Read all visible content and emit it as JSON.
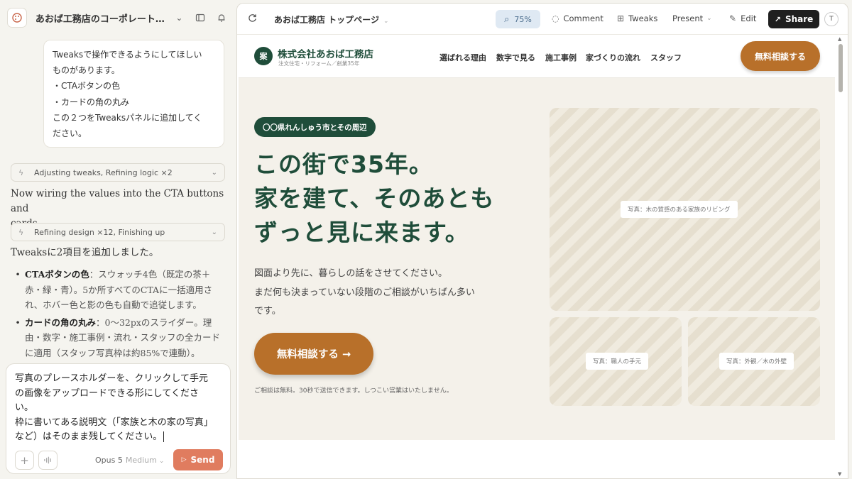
{
  "sidebar": {
    "project_title": "あおば工務店のコーポレート…",
    "user_message_lines": [
      "Tweaksで操作できるようにしてほしい",
      "ものがあります。",
      "・CTAボタンの色",
      "・カードの角の丸み",
      "この２つをTweaksパネルに追加してく",
      "ださい。"
    ],
    "status_1": "Adjusting tweaks, Refining logic ×2",
    "assistant_msg_1": [
      "Now wiring the values into the CTA buttons and",
      "cards."
    ],
    "status_2": "Refining design ×12, Finishing up",
    "assistant_msg_2": "Tweaksに2項目を追加しました。",
    "bullets": [
      {
        "title": "CTAボタンの色",
        "lines": [
          "：スウォッチ4色（既定の茶＋",
          "赤・緑・青）。5か所すべてのCTAに一括適用さ",
          "れ、ホバー色と影の色も自動で追従します。"
        ]
      },
      {
        "title": "カードの角の丸み",
        "lines": [
          "：0〜32pxのスライダー。理",
          "由・数字・施工事例・流れ・スタッフの全カード",
          "に適用（スタッフ写真枠は約85%で連動）。"
        ]
      }
    ],
    "composer_text": "写真のプレースホルダーを、クリックして手元\nの画像をアップロードできる形にしてくださ\nい。\n枠に書いてある説明文（「家族と木の家の写真」\nなど）はそのまま残してください。",
    "model_name": "Opus 5",
    "model_level": "Medium",
    "send_label": "Send"
  },
  "preview_toolbar": {
    "page_title": "あおば工務店 トップページ",
    "zoom": "75%",
    "comment_label": "Comment",
    "tweaks_label": "Tweaks",
    "present_label": "Present",
    "edit_label": "Edit",
    "share_label": "Share",
    "avatar_initial": "T"
  },
  "site": {
    "logo_mark": "案",
    "company_name": "株式会社あおば工務店",
    "company_sub": "注文住宅・リフォーム／創業35年",
    "nav_links": [
      "選ばれる理由",
      "数字で見る",
      "施工事例",
      "家づくりの流れ",
      "スタッフ"
    ],
    "nav_cta": "無料相談する",
    "region_badge": "〇〇県れんしゅう市とその周辺",
    "headline_lines": [
      "この街で35年。",
      "家を建て、そのあとも",
      "ずっと見に来ます。"
    ],
    "lead_lines": [
      "図面より先に、暮らしの話をさせてください。",
      "まだ何も決まっていない段階のご相談がいちばん多い",
      "です。"
    ],
    "hero_cta": "無料相談する →",
    "note": "ご相談は無料。30秒で送信できます。しつこい営業はいたしません。",
    "photos": {
      "main": "写真：木の質感のある家族のリビング",
      "sub1": "写真：職人の手元",
      "sub2": "写真：外観／木の外壁"
    }
  },
  "colors": {
    "brand_green": "#1f4d3a",
    "cta_brown": "#b8702a",
    "send_orange": "#e07c5f"
  }
}
